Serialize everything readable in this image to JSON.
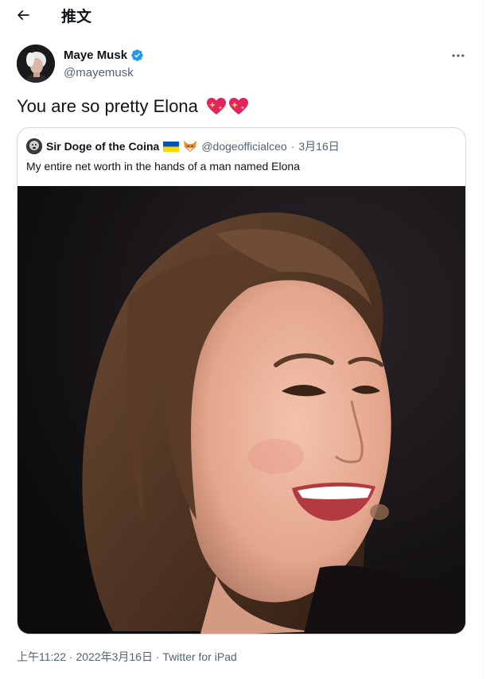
{
  "header": {
    "title": "推文",
    "back_icon": "arrow-left-icon"
  },
  "tweet": {
    "author_name": "Maye Musk",
    "author_handle": "@mayemusk",
    "verified": true,
    "text": "You are so pretty Elona",
    "emoji": [
      "sparkling-heart",
      "sparkling-heart"
    ],
    "more_icon": "more-horizontal-icon"
  },
  "quote": {
    "author_name": "Sir Doge of the Coina",
    "author_handle": "@dogeofficialceo",
    "separator": "·",
    "date": "3月16日",
    "text": "My entire net worth in the hands of a man named Elona",
    "badges": [
      "ukraine-flag",
      "fox-emoji"
    ]
  },
  "meta": {
    "time": "上午11:22",
    "separator": "·",
    "date": "2022年3月16日",
    "source": "Twitter for iPad"
  },
  "colors": {
    "text": "#0f1419",
    "secondary": "#536471",
    "verified_blue": "#1d9bf0",
    "border": "#cfd9de"
  }
}
